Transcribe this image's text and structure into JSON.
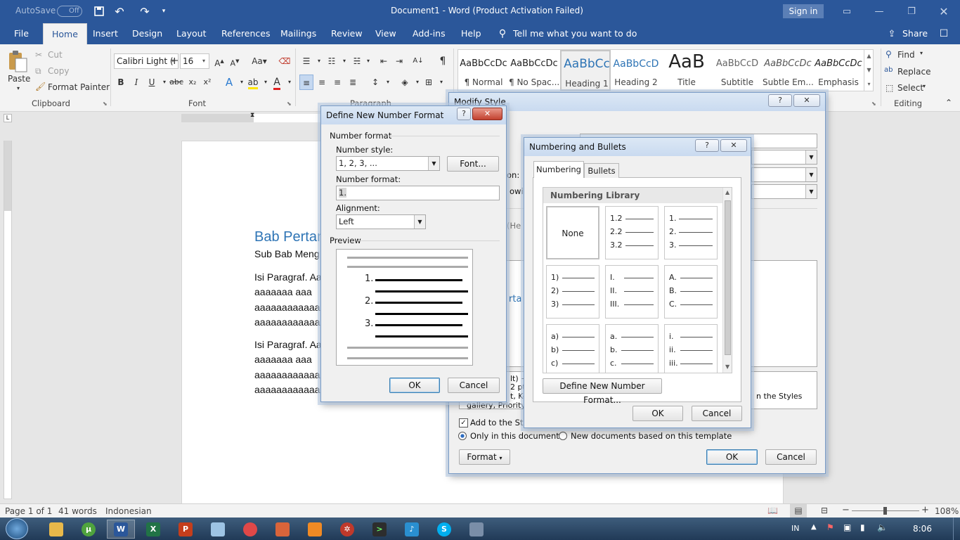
{
  "titlebar": {
    "autosave_label": "AutoSave",
    "autosave_state": "Off",
    "title": "Document1  -  Word (Product Activation Failed)",
    "signin": "Sign in"
  },
  "tabs": [
    "File",
    "Home",
    "Insert",
    "Design",
    "Layout",
    "References",
    "Mailings",
    "Review",
    "View",
    "Add-ins",
    "Help"
  ],
  "tell_me": "Tell me what you want to do",
  "share": "Share",
  "clipboard": {
    "paste": "Paste",
    "cut": "Cut",
    "copy": "Copy",
    "format_painter": "Format Painter",
    "group": "Clipboard"
  },
  "font": {
    "name": "Calibri Light (H",
    "size": "16",
    "group": "Font"
  },
  "paragraph": {
    "group": "Paragraph"
  },
  "styles": [
    {
      "preview": "AaBbCcDc",
      "name": "¶ Normal"
    },
    {
      "preview": "AaBbCcDc",
      "name": "¶ No Spac..."
    },
    {
      "preview": "AaBbCc",
      "name": "Heading 1"
    },
    {
      "preview": "AaBbCcD",
      "name": "Heading 2"
    },
    {
      "preview": "AaB",
      "name": "Title"
    },
    {
      "preview": "AaBbCcD",
      "name": "Subtitle"
    },
    {
      "preview": "AaBbCcDc",
      "name": "Subtle Em..."
    },
    {
      "preview": "AaBbCcDc",
      "name": "Emphasis"
    }
  ],
  "editing": {
    "find": "Find",
    "replace": "Replace",
    "select": "Select",
    "group": "Editing"
  },
  "document": {
    "heading": "Bab Pertan",
    "subheading": "Sub Bab Meng",
    "para1": [
      "Isi Paragraf. Aa",
      "aaaaaaa  aaa",
      "aaaaaaaaaaaa",
      "aaaaaaaaaaaa"
    ],
    "para2": [
      "Isi Paragraf. Aa",
      "aaaaaaa  aaa",
      "aaaaaaaaaaaa",
      "aaaaaaaaaaaa"
    ]
  },
  "status": {
    "page": "Page 1 of 1",
    "words": "41 words",
    "language": "Indonesian",
    "zoom": "108%"
  },
  "taskbar": {
    "lang": "IN",
    "time": "8:06"
  },
  "modify_style": {
    "title": "Modify Style",
    "frag_on": "on:",
    "frag_owi": "owi",
    "frag_he": "(He",
    "frag_rta": "rta",
    "desc_frag": [
      "lt) +",
      "2 pt",
      "t, Ke"
    ],
    "desc_right": "n the Styles",
    "desc_bottom": "gallery, Priority:",
    "add_to_styles": "Add to the Styl",
    "only_this_doc": "Only in this document",
    "new_docs": "New documents based on this template",
    "format": "Format",
    "ok": "OK",
    "cancel": "Cancel"
  },
  "numbering_bullets": {
    "title": "Numbering and Bullets",
    "tab_numbering": "Numbering",
    "tab_bullets": "Bullets",
    "library": "Numbering Library",
    "none": "None",
    "cells": [
      [
        "1.2",
        "2.2",
        "3.2"
      ],
      [
        "1.",
        "2.",
        "3."
      ],
      [
        "1)",
        "2)",
        "3)"
      ],
      [
        "I.",
        "II.",
        "III."
      ],
      [
        "A.",
        "B.",
        "C."
      ],
      [
        "a)",
        "b)",
        "c)"
      ],
      [
        "a.",
        "b.",
        "c."
      ],
      [
        "i.",
        "ii.",
        "iii."
      ]
    ],
    "define_new": "Define New Number Format...",
    "ok": "OK",
    "cancel": "Cancel"
  },
  "define_format": {
    "title": "Define New Number Format",
    "section_number_format": "Number format",
    "number_style_label": "Number style:",
    "number_style_value": "1, 2, 3, ...",
    "font_button": "Font...",
    "number_format_label": "Number format:",
    "number_format_value": "1.",
    "alignment_label": "Alignment:",
    "alignment_value": "Left",
    "preview_label": "Preview",
    "preview_numbers": [
      "1.",
      "2.",
      "3."
    ],
    "ok": "OK",
    "cancel": "Cancel"
  }
}
